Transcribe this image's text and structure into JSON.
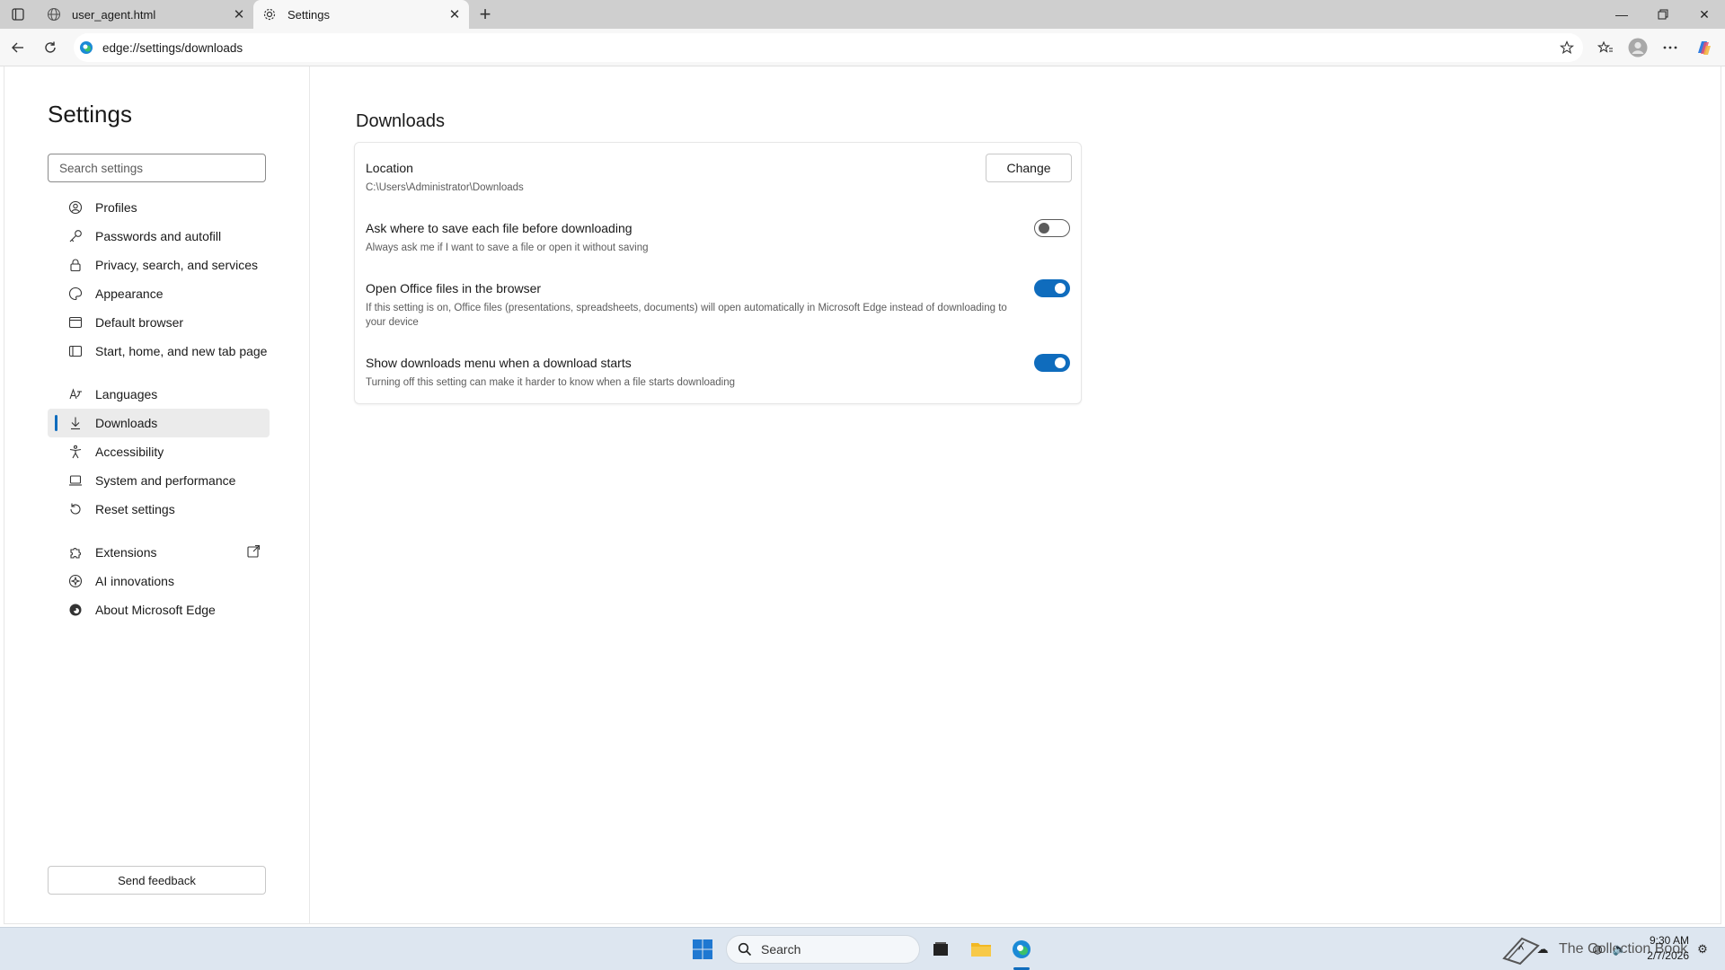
{
  "browser": {
    "tabs": [
      {
        "title": "user_agent.html",
        "icon": "globe-icon",
        "active": false
      },
      {
        "title": "Settings",
        "icon": "gear-icon",
        "active": true
      }
    ],
    "address": "edge://settings/downloads"
  },
  "sidebar": {
    "title": "Settings",
    "search_placeholder": "Search settings",
    "items": [
      {
        "label": "Profiles",
        "icon": "profile-icon"
      },
      {
        "label": "Passwords and autofill",
        "icon": "key-icon"
      },
      {
        "label": "Privacy, search, and services",
        "icon": "lock-icon"
      },
      {
        "label": "Appearance",
        "icon": "appearance-icon"
      },
      {
        "label": "Default browser",
        "icon": "browser-icon"
      },
      {
        "label": "Start, home, and new tab page",
        "icon": "home-icon"
      },
      {
        "label": "Languages",
        "icon": "languages-icon"
      },
      {
        "label": "Downloads",
        "icon": "download-icon",
        "selected": true
      },
      {
        "label": "Accessibility",
        "icon": "accessibility-icon"
      },
      {
        "label": "System and performance",
        "icon": "laptop-icon"
      },
      {
        "label": "Reset settings",
        "icon": "reset-icon"
      },
      {
        "label": "Extensions",
        "icon": "puzzle-icon"
      },
      {
        "label": "AI innovations",
        "icon": "ai-icon"
      },
      {
        "label": "About Microsoft Edge",
        "icon": "edge-icon"
      }
    ],
    "feedback": "Send feedback"
  },
  "downloads": {
    "title": "Downloads",
    "location": {
      "title": "Location",
      "path": "C:\\Users\\Administrator\\Downloads",
      "button": "Change"
    },
    "ask_where": {
      "title": "Ask where to save each file before downloading",
      "description": "Always ask me if I want to save a file or open it without saving",
      "enabled": false
    },
    "office": {
      "title": "Open Office files in the browser",
      "description": "If this setting is on, Office files (presentations, spreadsheets, documents) will open automatically in Microsoft Edge instead of downloading to your device",
      "enabled": true
    },
    "show_menu": {
      "title": "Show downloads menu when a download starts",
      "description": "Turning off this setting can make it harder to know when a file starts downloading",
      "enabled": true
    }
  },
  "taskbar": {
    "search_label": "Search",
    "time": "9:30 AM",
    "date": "2/7/2026",
    "tray_text": "The Collection Book"
  },
  "colors": {
    "accent": "#0f6cbd",
    "selected_bg": "#ebebeb",
    "tabstrip_bg": "#cfcfcf"
  }
}
